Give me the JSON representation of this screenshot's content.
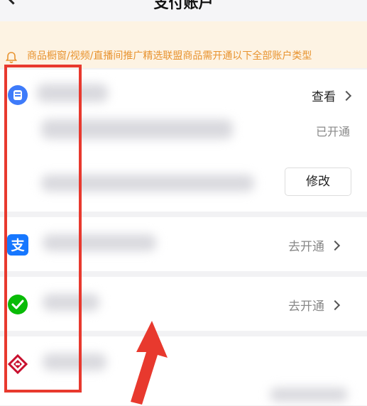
{
  "header": {
    "title": "支付账户"
  },
  "notice": {
    "text": "商品橱窗/视频/直播间推广精选联盟商品需开通以下全部账户类型"
  },
  "accounts": [
    {
      "action": "查看",
      "status": "已开通",
      "edit_label": "修改"
    },
    {
      "action": "去开通"
    },
    {
      "action": "去开通"
    }
  ],
  "colors": {
    "accent": "#e8932f",
    "highlight": "#e8392e",
    "alipay": "#1677ff",
    "wechat": "#09bb07",
    "douyin_pay": "#3e7bfa",
    "bank": "#c8102e"
  }
}
